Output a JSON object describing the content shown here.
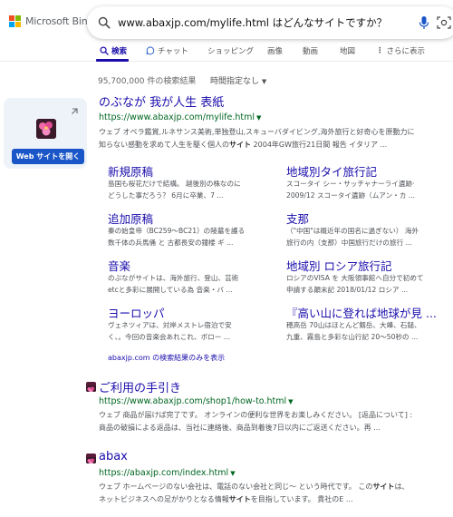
{
  "brand": {
    "name": "Microsoft Bing",
    "colors": [
      "#f25022",
      "#7fba00",
      "#00a4ef",
      "#ffb900"
    ]
  },
  "search": {
    "query": "www.abaxjp.com/mylife.html はどんなサイトですか？"
  },
  "tabs": [
    {
      "label": "検索",
      "icon": "search-icon",
      "active": true
    },
    {
      "label": "チャット",
      "icon": "chat-icon",
      "active": false
    },
    {
      "label": "ショッピング",
      "active": false
    },
    {
      "label": "画像",
      "active": false
    },
    {
      "label": "動画",
      "active": false
    },
    {
      "label": "地図",
      "active": false
    },
    {
      "label": "さらに表示",
      "icon": "more-icon",
      "active": false
    }
  ],
  "results_count": "95,700,000 件の検索結果",
  "time_filter": "時間指定なし",
  "sidebar": {
    "button": "Web サイトを開く"
  },
  "results": [
    {
      "title": "のぶなが 我が人生 表紙",
      "url": "https://www.abaxjp.com/mylife.html",
      "snippet_1": "ウェブ オペラ鑑賞,ルネサンス美術,単独登山,スキューバダイビング,海外旅行と好奇心を原動力に",
      "snippet_2a": "知らない感動を求めて人生を駆く個人の",
      "snippet_2b": "サイト",
      "snippet_2c": " 2004年GW旅行21日間 報告 イタリア ..."
    },
    {
      "title": "ご利用の手引き",
      "url": "https://www.abaxjp.com/shop1/how-to.html",
      "snippet_1": "ウェブ 商品が届けば完了です。 オンラインの便利な世界をお楽しみください。 [返品について] :",
      "snippet_2": "商品の破損による返品は、当社に連絡後、商品到着後7日以内にご返送ください。再 ..."
    },
    {
      "title": "abax",
      "url": "https://abaxjp.com/index.html",
      "snippet_1a": "ウェブ ホームページのない会社は、電話のない会社と同じ〜 という時代です。 この",
      "snippet_1b": "サイト",
      "snippet_1c": "は、",
      "snippet_2a": "ネットビジネスへの足がかりとなる情報",
      "snippet_2b": "サイト",
      "snippet_2c": "を目指しています。 貴社のE ..."
    }
  ],
  "deeplinks": [
    {
      "title": "新規原稿",
      "l1": "島国も桜花だけで結構。 越後別の株なのに",
      "l2": "どうした事だろう？ 6月に卒業、7 ..."
    },
    {
      "title": "地域別タイ旅行記",
      "l1": "スコータイ シー・サッチャナーライ遺跡·",
      "l2": "2009/12 スコータイ遺跡（ムアン・カ ..."
    },
    {
      "title": "追加原稿",
      "l1": "秦の始皇帝（BC259〜BC21）の陵墓を護る",
      "l2": "数千体の兵馬俑 と 古都長安の鐘楼 ギ ..."
    },
    {
      "title": "支那",
      "l1": "（\"中国\"は概近年の国名に過ぎない） 海外",
      "l2": "旅行の内（支那）中国旅行だけの旅行 ..."
    },
    {
      "title": "音楽",
      "l1": "のぶながサイトは、海外旅行、登山、芸術",
      "l2": "etcと多彩に展開している為 音楽・バ ..."
    },
    {
      "title": "地域別 ロシア旅行記",
      "l1": "ロシアのVISA を 大阪領事館へ自分で初めて",
      "l2": "申請する顛末記 2018/01/12 ロシア ..."
    },
    {
      "title": "ヨーロッパ",
      "l1": "ヴェネツィアは、対岸メストレ宿泊で安",
      "l2": "く、。今回の音楽会あれこれ、ボロー ..."
    },
    {
      "title": "『高い山に登れば地球が見 ...",
      "l1": "穂高岳 70山はほとんど剱岳、大峰、石鎚、",
      "l2": "九重、霧島と多彩な山行記 20〜50秒の ..."
    }
  ],
  "site_only": "abaxjp.com の検索結果のみを表示"
}
